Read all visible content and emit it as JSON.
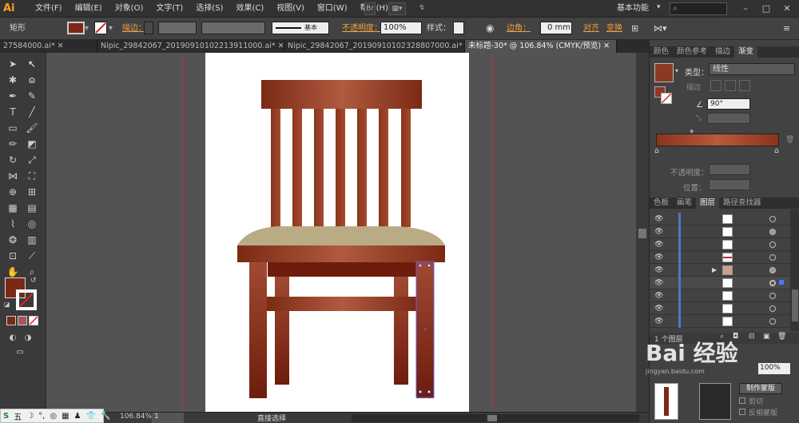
{
  "app": {
    "logo": "Ai"
  },
  "menu": {
    "items": [
      "文件(F)",
      "编辑(E)",
      "对象(O)",
      "文字(T)",
      "选择(S)",
      "效果(C)",
      "视图(V)",
      "窗口(W)",
      "帮助(H)"
    ]
  },
  "topbar": {
    "br_label": "Br",
    "workspace": "基本功能",
    "search_placeholder": ""
  },
  "control": {
    "object_type": "矩形",
    "stroke_label": "描边：",
    "stroke_style": "基本",
    "opacity_label": "不透明度：",
    "opacity_value": "100%",
    "style_label": "样式：",
    "corner_label": "边角：",
    "corner_value": "0 mm",
    "align_label": "对齐",
    "transform_label": "变换"
  },
  "tabs": [
    {
      "label": "27584000.ai*"
    },
    {
      "label": "Nipic_29842067_20190910102213911000.ai*"
    },
    {
      "label": "Nipic_29842067_20190910102328807000.ai*"
    },
    {
      "label": "未标题-30* @ 106.84% (CMYK/预览)"
    }
  ],
  "gradient_panel": {
    "tabs": [
      "颜色",
      "颜色参考",
      "描边",
      "渐变"
    ],
    "type_label": "类型：",
    "type_value": "线性",
    "stroke_label": "描边",
    "angle_value": "90°",
    "opacity_label": "不透明度：",
    "position_label": "位置："
  },
  "layers_panel": {
    "tabs": [
      "色板",
      "画笔",
      "图层",
      "路径查找器"
    ],
    "footer": "1 个图层"
  },
  "right_lower": {
    "mask_label": "制作蒙版",
    "clip_label": "剪切",
    "invert_label": "反相蒙版"
  },
  "status": {
    "zoom": "106.84%",
    "page": "1",
    "tool": "直接选择"
  },
  "watermark": {
    "text": "Bai 经验",
    "sub": "jingyan.baidu.com"
  },
  "sysbar": {
    "items": [
      "S",
      "五",
      "☽",
      "°,",
      "◎",
      "▦",
      "♟",
      "👕",
      "🔧"
    ]
  },
  "colors": {
    "chair_dark": "#7a2a14",
    "chair_mid": "#b05a40",
    "seat": "#b9ab84",
    "accent_guide": "#c4303a"
  }
}
